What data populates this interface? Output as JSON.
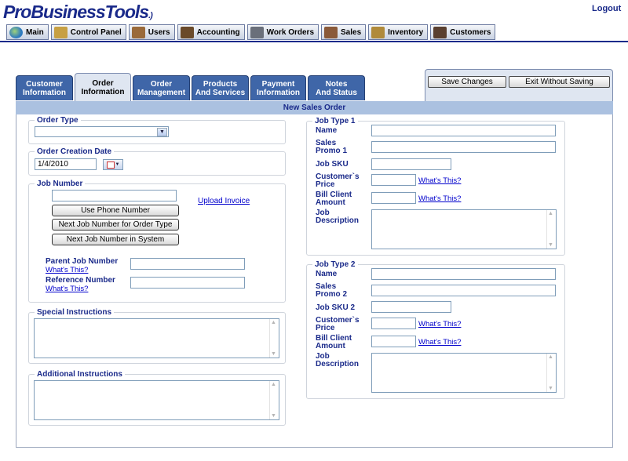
{
  "header": {
    "logo": "ProBusinessTools",
    "logo_mark": ".)",
    "logout": "Logout"
  },
  "topnav": [
    {
      "label": "Main",
      "icon": "globe-icon",
      "color": "#2f7bbf"
    },
    {
      "label": "Control Panel",
      "icon": "wrench-icon",
      "color": "#c7a043"
    },
    {
      "label": "Users",
      "icon": "users-icon",
      "color": "#9a6a3a"
    },
    {
      "label": "Accounting",
      "icon": "accountant-icon",
      "color": "#6a4a2a"
    },
    {
      "label": "Work Orders",
      "icon": "printer-icon",
      "color": "#6a6f7a"
    },
    {
      "label": "Sales",
      "icon": "salesperson-icon",
      "color": "#8a5a3a"
    },
    {
      "label": "Inventory",
      "icon": "box-icon",
      "color": "#b08a3a"
    },
    {
      "label": "Customers",
      "icon": "customers-icon",
      "color": "#5a4030"
    }
  ],
  "tabs": [
    {
      "line1": "Customer",
      "line2": "Information",
      "active": false
    },
    {
      "line1": "Order",
      "line2": "Information",
      "active": true
    },
    {
      "line1": "Order",
      "line2": "Management",
      "active": false
    },
    {
      "line1": "Products",
      "line2": "And Services",
      "active": false
    },
    {
      "line1": "Payment",
      "line2": "Information",
      "active": false
    },
    {
      "line1": "Notes",
      "line2": "And Status",
      "active": false
    }
  ],
  "actions": {
    "save": "Save Changes",
    "exit": "Exit Without Saving"
  },
  "form_title": "New Sales Order",
  "left": {
    "order_type": {
      "legend": "Order Type",
      "value": ""
    },
    "order_date": {
      "legend": "Order Creation Date",
      "value": "1/4/2010"
    },
    "job_number": {
      "legend": "Job Number",
      "value": "",
      "upload": "Upload Invoice",
      "btn_phone": "Use Phone Number",
      "btn_next_type": "Next Job Number for Order Type",
      "btn_next_system": "Next Job Number in System",
      "parent_label": "Parent Job Number",
      "reference_label": "Reference Number",
      "whats_this": "What's This?"
    },
    "special": {
      "legend": "Special Instructions"
    },
    "additional": {
      "legend": "Additional Instructions"
    }
  },
  "right": {
    "job1": {
      "legend": "Job Type 1",
      "name": "Name",
      "promo_l1": "Sales",
      "promo_l2": "Promo 1",
      "sku": "Job SKU",
      "price_l1": "Customer`s",
      "price_l2": "Price",
      "bill_l1": "Bill Client",
      "bill_l2": "Amount",
      "desc_l1": "Job",
      "desc_l2": "Description",
      "whats_this": "What's This?"
    },
    "job2": {
      "legend": "Job Type 2",
      "name": "Name",
      "promo_l1": "Sales",
      "promo_l2": "Promo 2",
      "sku": "Job SKU 2",
      "price_l1": "Customer`s",
      "price_l2": "Price",
      "bill_l1": "Bill Client",
      "bill_l2": "Amount",
      "desc_l1": "Job",
      "desc_l2": "Description",
      "whats_this": "What's This?"
    }
  }
}
